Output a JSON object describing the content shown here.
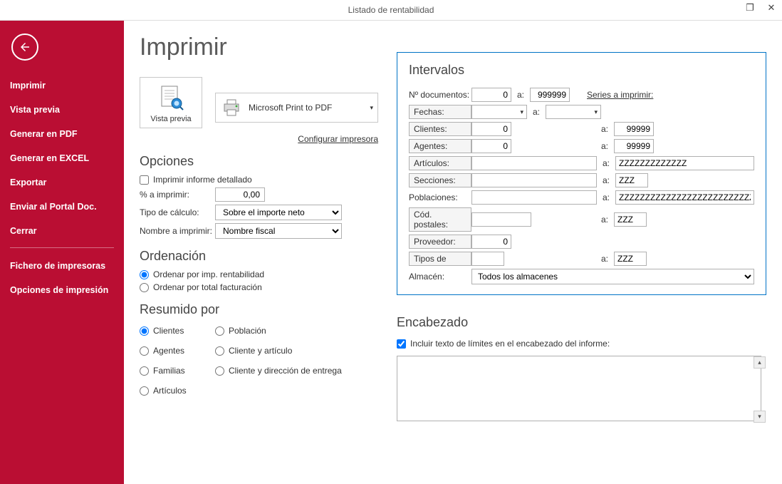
{
  "titlebar": {
    "title": "Listado de rentabilidad"
  },
  "sidebar": {
    "items": [
      "Imprimir",
      "Vista previa",
      "Generar en PDF",
      "Generar en EXCEL",
      "Exportar",
      "Enviar al Portal Doc.",
      "Cerrar"
    ],
    "items2": [
      "Fichero de impresoras",
      "Opciones de impresión"
    ]
  },
  "page": {
    "title": "Imprimir",
    "preview_label": "Vista previa",
    "printer_name": "Microsoft Print to PDF",
    "configure_printer": "Configurar impresora"
  },
  "options": {
    "heading": "Opciones",
    "detailed_label": "Imprimir informe detallado",
    "percent_label": "% a imprimir:",
    "percent_value": "0,00",
    "calc_label": "Tipo de cálculo:",
    "calc_value": "Sobre el importe neto",
    "name_label": "Nombre a imprimir:",
    "name_value": "Nombre fiscal"
  },
  "ordering": {
    "heading": "Ordenación",
    "opt1": "Ordenar por imp. rentabilidad",
    "opt2": "Ordenar por total facturación"
  },
  "summary": {
    "heading": "Resumido por",
    "col1": [
      "Clientes",
      "Agentes",
      "Familias",
      "Artículos"
    ],
    "col2": [
      "Población",
      "Cliente y artículo",
      "Cliente y dirección de entrega"
    ]
  },
  "intervals": {
    "heading": "Intervalos",
    "a": "a:",
    "doc_label": "Nº documentos:",
    "doc_from": "0",
    "doc_to": "999999",
    "series_link": "Series a imprimir:",
    "fechas_label": "Fechas:",
    "clientes_label": "Clientes:",
    "clientes_from": "0",
    "clientes_to": "99999",
    "agentes_label": "Agentes:",
    "agentes_from": "0",
    "agentes_to": "99999",
    "articulos_label": "Artículos:",
    "articulos_to": "ZZZZZZZZZZZZZ",
    "secciones_label": "Secciones:",
    "secciones_to": "ZZZ",
    "poblaciones_label": "Poblaciones:",
    "poblaciones_to": "ZZZZZZZZZZZZZZZZZZZZZZZZZZZZZZZZZZZZZZZZ",
    "codpost_label": "Cód. postales:",
    "codpost_to": "ZZZ",
    "proveedor_label": "Proveedor:",
    "proveedor_val": "0",
    "tipos_label": "Tipos de",
    "tipos_to": "ZZZ",
    "almacen_label": "Almacén:",
    "almacen_value": "Todos los almacenes"
  },
  "header_section": {
    "heading": "Encabezado",
    "include_label": "Incluir texto de límites en el encabezado del informe:"
  }
}
